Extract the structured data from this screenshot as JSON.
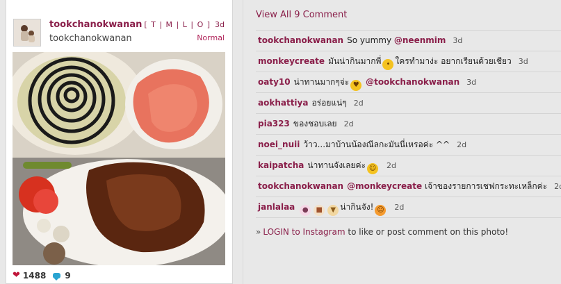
{
  "post": {
    "username": "tookchanokwanan",
    "full_name": "tookchanokwanan",
    "links": "[ T | M | L | O ]",
    "age": "3d",
    "filter": "Normal",
    "likes": "1488",
    "comments_count": "9"
  },
  "comments_header": "View All 9 Comment",
  "comments": [
    {
      "user": "tookchanokwanan",
      "text": "So yummy",
      "mention": "@neenmim",
      "ago": "3d"
    },
    {
      "user": "monkeycreate",
      "text": "มันน่ากินมากพี่",
      "text2": "ใครทำมาง่ะ อยากเรียนด้วยเชียว",
      "ago": "3d"
    },
    {
      "user": "oaty10",
      "text": "น่าทานมากๆจ่ะ",
      "mention": "@tookchanokwanan",
      "ago": "3d"
    },
    {
      "user": "aokhattiya",
      "text": "อร่อยแน่ๆ",
      "ago": "2d"
    },
    {
      "user": "pia323",
      "text": "ของชอบเลย",
      "ago": "2d"
    },
    {
      "user": "noei_nuii",
      "text": "ว้าว...มาบ้านน้องณีลกะมันนี่เหรอค่ะ ^^",
      "ago": "2d"
    },
    {
      "user": "kaipatcha",
      "text": "น่าทานจังเลยค่ะ",
      "ago": "2d"
    },
    {
      "user": "tookchanokwanan",
      "mention": "@monkeycreate",
      "text": "เจ้าของรายการเชฟกระทะเหล็กค่ะ",
      "ago": "2d"
    },
    {
      "user": "janlalaa",
      "text": "น่ากินจัง!",
      "ago": "2d"
    }
  ],
  "login": {
    "arrow": "»",
    "link": "LOGIN to Instagram",
    "rest": "to like or post comment on this photo!"
  },
  "icons": {
    "likes": "heart-icon",
    "comments": "comment-bubble-icon"
  },
  "colors": {
    "accent": "#8a1f4a",
    "heart": "#c0163a",
    "bubble": "#2aa4d1"
  }
}
